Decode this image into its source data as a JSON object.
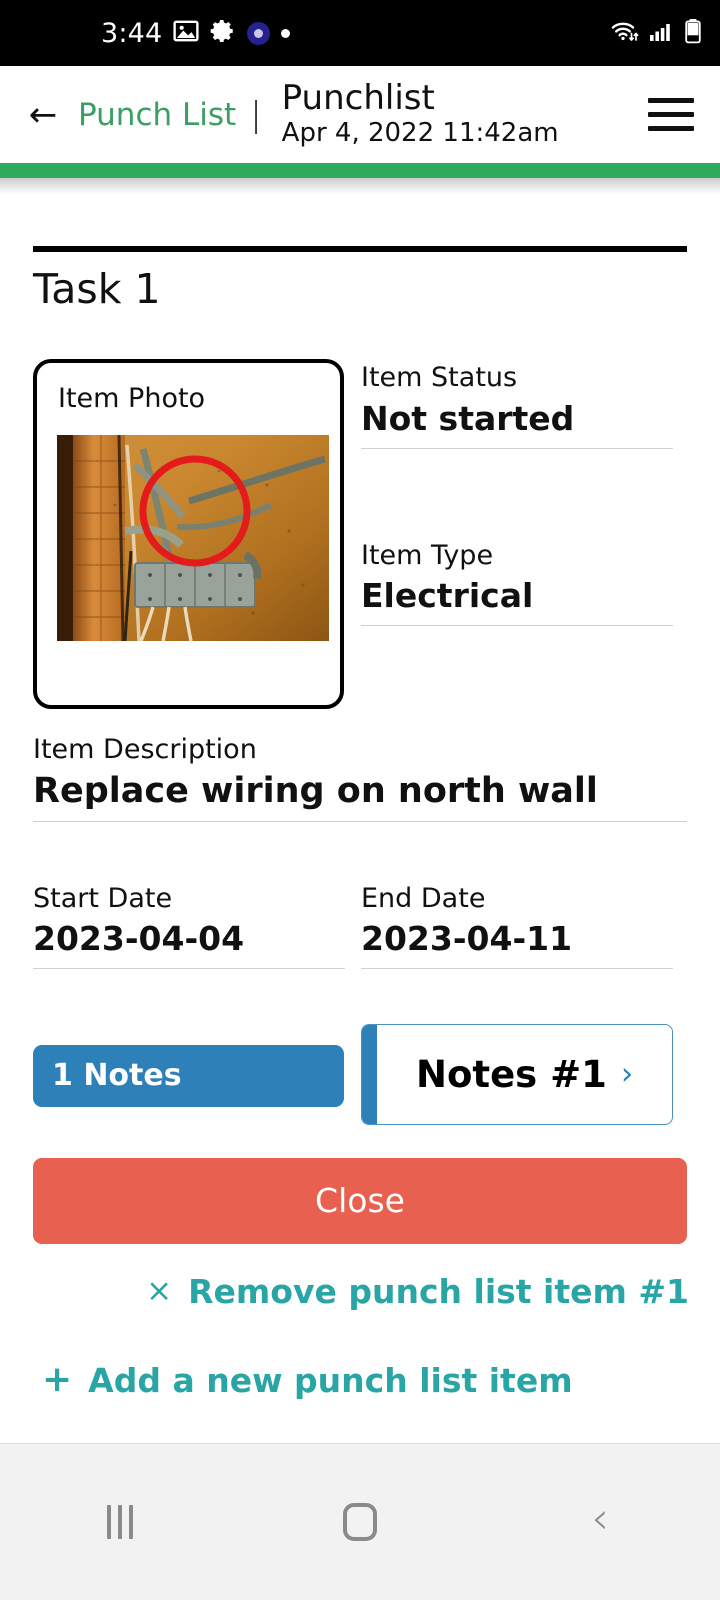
{
  "status_bar": {
    "time": "3:44",
    "left_icons": [
      "image-icon",
      "gear-icon",
      "app-badge-icon",
      "dot-icon"
    ],
    "right_icons": [
      "wifi-icon",
      "cellular-signal-icon",
      "battery-icon"
    ]
  },
  "header": {
    "back_icon": "←",
    "breadcrumb": "Punch List",
    "separator": "|",
    "title": "Punchlist",
    "subtitle": "Apr 4, 2022 11:42am",
    "menu_icon": "hamburger-icon",
    "accent_green": "#2eaa5e",
    "breadcrumb_color": "#3d9e63"
  },
  "main": {
    "task_title": "Task 1",
    "photo": {
      "label": "Item Photo",
      "alt": "electrical-wiring-photo-with-red-circle-annotation",
      "annotation_color": "#e31b1b"
    },
    "fields": [
      {
        "label": "Item Status",
        "value": "Not started"
      },
      {
        "label": "Item Type",
        "value": "Electrical"
      }
    ],
    "description": {
      "label": "Item Description",
      "value": "Replace wiring on north wall"
    },
    "dates": [
      {
        "label": "Start Date",
        "value": "2023-04-04"
      },
      {
        "label": "End Date",
        "value": "2023-04-11"
      }
    ]
  },
  "actions": {
    "notes_count_label": "1 Notes",
    "notes_card_label": "Notes #1",
    "notes_card_chevron": "›",
    "close_label": "Close",
    "remove_icon": "×",
    "remove_label": "Remove punch list item #1",
    "add_icon": "+",
    "add_label": "Add a new punch list item",
    "colors": {
      "notes_blue": "#2e80b9",
      "close_red": "#e8604f",
      "link_teal": "#2aa5a5"
    }
  },
  "nav_bar": {
    "recent_icon": "recent-apps-icon",
    "home_icon": "home-icon",
    "back_icon": "back-icon"
  }
}
